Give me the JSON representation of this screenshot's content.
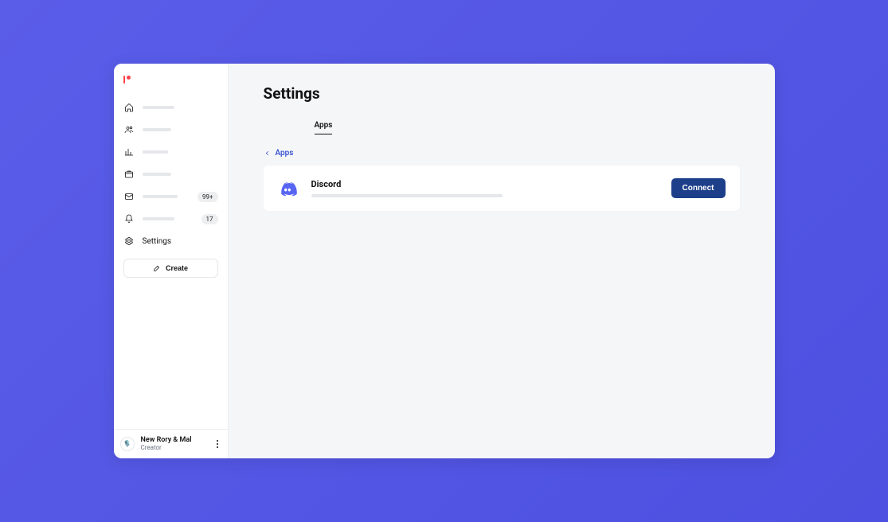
{
  "sidebar": {
    "items": [
      {
        "icon": "home-icon"
      },
      {
        "icon": "users-icon"
      },
      {
        "icon": "chart-icon"
      },
      {
        "icon": "package-icon"
      },
      {
        "icon": "mail-icon",
        "badge": "99+"
      },
      {
        "icon": "bell-icon",
        "badge": "17"
      },
      {
        "icon": "settings-icon",
        "label": "Settings"
      }
    ],
    "create_label": "Create"
  },
  "user": {
    "name": "New Rory & Mal",
    "role": "Creator"
  },
  "page": {
    "title": "Settings",
    "tabs": {
      "active_label": "Apps"
    },
    "breadcrumb": {
      "label": "Apps"
    }
  },
  "integration": {
    "name": "Discord",
    "connect_label": "Connect"
  },
  "colors": {
    "accent": "#5865F2",
    "brand": "#ff424d",
    "primary_button": "#1d3f8a"
  }
}
